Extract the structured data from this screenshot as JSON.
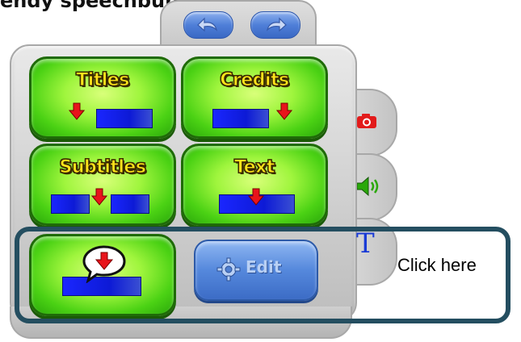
{
  "header": {
    "title_fragment": "endy speechbubb"
  },
  "toolbar": {
    "undo_icon": "undo-arrow-icon",
    "redo_icon": "redo-arrow-icon"
  },
  "buttons": {
    "titles": {
      "label": "Titles"
    },
    "credits": {
      "label": "Credits"
    },
    "subtitles": {
      "label": "Subtitles"
    },
    "text": {
      "label": "Text"
    },
    "speech_bubble": {
      "icon": "speech-bubble-download-icon"
    },
    "edit": {
      "label": "Edit",
      "icon": "gear-icon"
    }
  },
  "side_tabs": {
    "camera": {
      "icon": "camera-icon",
      "color": "#e21b1b"
    },
    "audio": {
      "icon": "speaker-icon",
      "color": "#2aa80a"
    },
    "text": {
      "label": "T",
      "color": "#1a3bd6"
    }
  },
  "annotation": {
    "label": "Click here",
    "color": "#244e60"
  },
  "colors": {
    "green_button": "#4bd214",
    "blue_bar": "#1a26ff",
    "arrow_red": "#e8141b",
    "label_yellow": "#ffe41a"
  }
}
